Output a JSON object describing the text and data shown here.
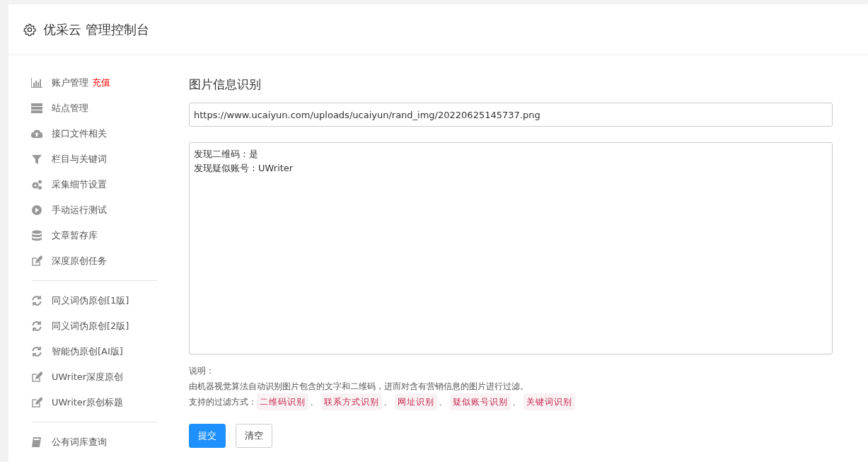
{
  "header": {
    "title": "优采云 管理控制台"
  },
  "sidebar": {
    "groups": [
      {
        "items": [
          {
            "label": "账户管理",
            "badge": "充值",
            "kind": "chart"
          },
          {
            "label": "站点管理",
            "kind": "server"
          },
          {
            "label": "接口文件相关",
            "kind": "cloud"
          },
          {
            "label": "栏目与关键词",
            "kind": "filter"
          },
          {
            "label": "采集细节设置",
            "kind": "gears"
          },
          {
            "label": "手动运行测试",
            "kind": "play"
          },
          {
            "label": "文章暂存库",
            "kind": "database"
          },
          {
            "label": "深度原创任务",
            "kind": "edit"
          }
        ]
      },
      {
        "items": [
          {
            "label": "同义词伪原创[1版]",
            "kind": "refresh"
          },
          {
            "label": "同义词伪原创[2版]",
            "kind": "refresh"
          },
          {
            "label": "智能伪原创[AI版]",
            "kind": "refresh"
          },
          {
            "label": "UWriter深度原创",
            "kind": "edit"
          },
          {
            "label": "UWriter原创标题",
            "kind": "edit"
          }
        ]
      },
      {
        "items": [
          {
            "label": "公有词库查询",
            "kind": "book"
          }
        ]
      }
    ]
  },
  "main": {
    "heading": "图片信息识别",
    "url_field": {
      "value": "https://www.ucaiyun.com/uploads/ucaiyun/rand_img/20220625145737.png"
    },
    "result_box": {
      "lines": [
        "发现二维码：是",
        "发现疑似账号：UWriter"
      ]
    },
    "note_title": "说明：",
    "note_text": "由机器视觉算法自动识别图片包含的文字和二维码，进而对含有营销信息的图片进行过滤。",
    "filters_label": "支持的过滤方式：",
    "filter_tags": [
      "二维码识别",
      "联系方式识别",
      "网址识别",
      "疑似账号识别",
      "关键词识别"
    ],
    "separator": "、",
    "buttons": [
      {
        "label": "提交",
        "kind": "primary"
      },
      {
        "label": "清空",
        "kind": "default"
      }
    ]
  }
}
